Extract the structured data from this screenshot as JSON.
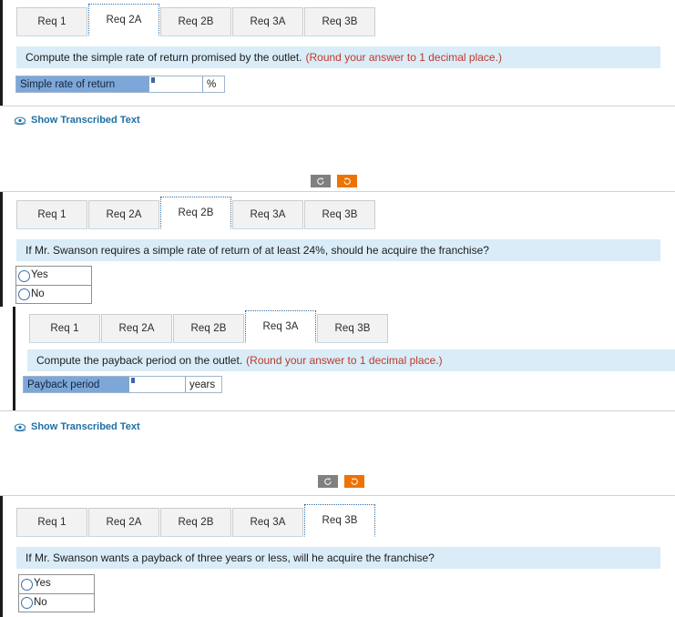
{
  "tabs": {
    "labels": [
      "Req 1",
      "Req 2A",
      "Req 2B",
      "Req 3A",
      "Req 3B"
    ]
  },
  "links": {
    "show_transcribed": "Show Transcribed Text",
    "eye_icon": "eye-icon"
  },
  "nav": {
    "prev_icon": "undo-arrow-icon",
    "next_icon": "redo-arrow-icon",
    "prev_color": "#808080",
    "next_color": "#ec7404"
  },
  "colors": {
    "question_bar": "#d9ecf7",
    "answer_label": "#7da7d9",
    "hint_text": "#c0392b",
    "link": "#1d6fa5",
    "radio_outline": "#3b6ea8"
  },
  "sections": [
    {
      "id": "req2a",
      "active_tab": "Req 2A",
      "question": "Compute the simple rate of return promised by the outlet.",
      "hint": "(Round your answer to 1 decimal place.)",
      "answer": {
        "label": "Simple rate of return",
        "value": "",
        "unit": "%"
      }
    },
    {
      "id": "req2b",
      "active_tab": "Req 2B",
      "question": "If Mr. Swanson requires a simple rate of return of at least 24%, should he acquire the franchise?",
      "hint": "",
      "options": [
        "Yes",
        "No"
      ]
    },
    {
      "id": "req3a",
      "active_tab": "Req 3A",
      "question": "Compute the payback period on the outlet.",
      "hint": "(Round your answer to 1 decimal place.)",
      "answer": {
        "label": "Payback period",
        "value": "",
        "unit": "years"
      }
    },
    {
      "id": "req3b",
      "active_tab": "Req 3B",
      "question": "If Mr. Swanson wants a payback of three years or less, will he acquire the franchise?",
      "hint": "",
      "options": [
        "Yes",
        "No"
      ]
    }
  ]
}
